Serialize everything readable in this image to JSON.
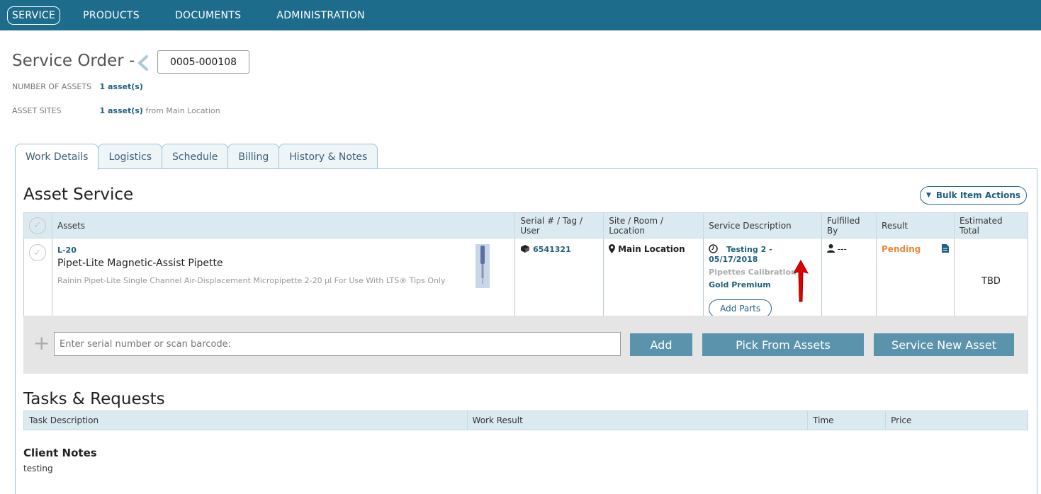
{
  "nav": {
    "items": [
      "SERVICE",
      "PRODUCTS",
      "DOCUMENTS",
      "ADMINISTRATION"
    ],
    "active": "SERVICE"
  },
  "header": {
    "title": "Service Order -",
    "order_number": "0005-000108",
    "num_assets_label": "NUMBER OF ASSETS",
    "num_assets_value": "1 asset(s)",
    "asset_sites_label": "ASSET SITES",
    "asset_sites_value": "1 asset(s)",
    "asset_sites_sub": "from Main Location"
  },
  "tabs": [
    "Work Details",
    "Logistics",
    "Schedule",
    "Billing",
    "History & Notes"
  ],
  "asset_service": {
    "title": "Asset Service",
    "bulk_label": "Bulk Item Actions",
    "columns": [
      "Assets",
      "Serial # / Tag / User",
      "Site / Room / Location",
      "Service Description",
      "Fulfilled By",
      "Result",
      "Estimated Total"
    ],
    "row": {
      "code": "L-20",
      "name": "Pipet-Lite Magnetic-Assist Pipette",
      "description": "Rainin Pipet-Lite Single Channel Air-Displacement Micropipette 2-20 µl For Use With LTS® Tips Only",
      "serial": "6541321",
      "location": "Main Location",
      "service_line": "Testing 2 - 05/17/2018",
      "service_type": "Pipettes Calibration",
      "service_plan": "Gold Premium",
      "add_parts": "Add Parts",
      "fulfilled_by": "---",
      "result": "Pending",
      "estimated_total": "TBD"
    },
    "input_placeholder": "Enter serial number or scan barcode:",
    "add_label": "Add",
    "pick_label": "Pick From Assets",
    "new_label": "Service New Asset"
  },
  "tasks": {
    "title": "Tasks & Requests",
    "columns": [
      "Task Description",
      "Work Result",
      "Time",
      "Price"
    ]
  },
  "client_notes": {
    "title": "Client Notes",
    "text": "testing"
  },
  "colors": {
    "nav_bg": "#1d6c8c",
    "accent": "#1d5f80",
    "button_bg": "#5a93ab",
    "pending": "#e9883a",
    "arrow": "#e00000"
  }
}
